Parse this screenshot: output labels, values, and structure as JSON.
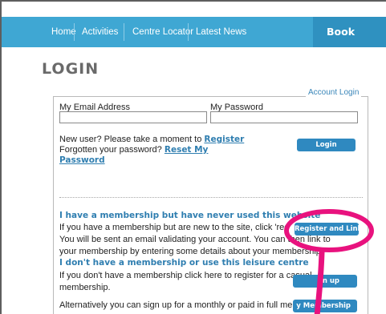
{
  "nav": {
    "items": [
      "Home",
      "Activities",
      "Centre Locator",
      "Latest News"
    ],
    "book_online": "Book Online"
  },
  "page": {
    "title": "LOGIN"
  },
  "login_box": {
    "legend": "Account Login",
    "email_label": "My Email Address",
    "email_value": "",
    "password_label": "My Password",
    "password_value": "",
    "new_user_text": "New user? Please take a moment to ",
    "register_link": "Register",
    "forgot_text": "Forgotten your password? ",
    "reset_link_line1": "Reset My",
    "reset_link_line2": "Password",
    "login_button": "Login"
  },
  "membership": {
    "heading": "I have a membership but have never used this website",
    "line1": "If you have a membership but are new to the site, click 'register and lin",
    "line2": "You will be sent an email validating your account. You can then link to",
    "line3": "your membership by entering some details about your membership.",
    "register_link_button": "Register and Link"
  },
  "no_membership": {
    "heading": "I don't have a membership or use this leisure centre",
    "line1": "If you don't have a membership click here to register for a casual",
    "line2": "membership.",
    "signup_button": "gn up",
    "line3": "Alternatively you can sign up for a monthly or paid in full membership.",
    "membership_button": "y Membership"
  },
  "colors": {
    "nav_bg": "#3fa7d3",
    "nav_book_bg": "#2f91c0",
    "button_bg": "#2f89c0",
    "link": "#2f7eb0",
    "annotation": "#e8127e"
  }
}
